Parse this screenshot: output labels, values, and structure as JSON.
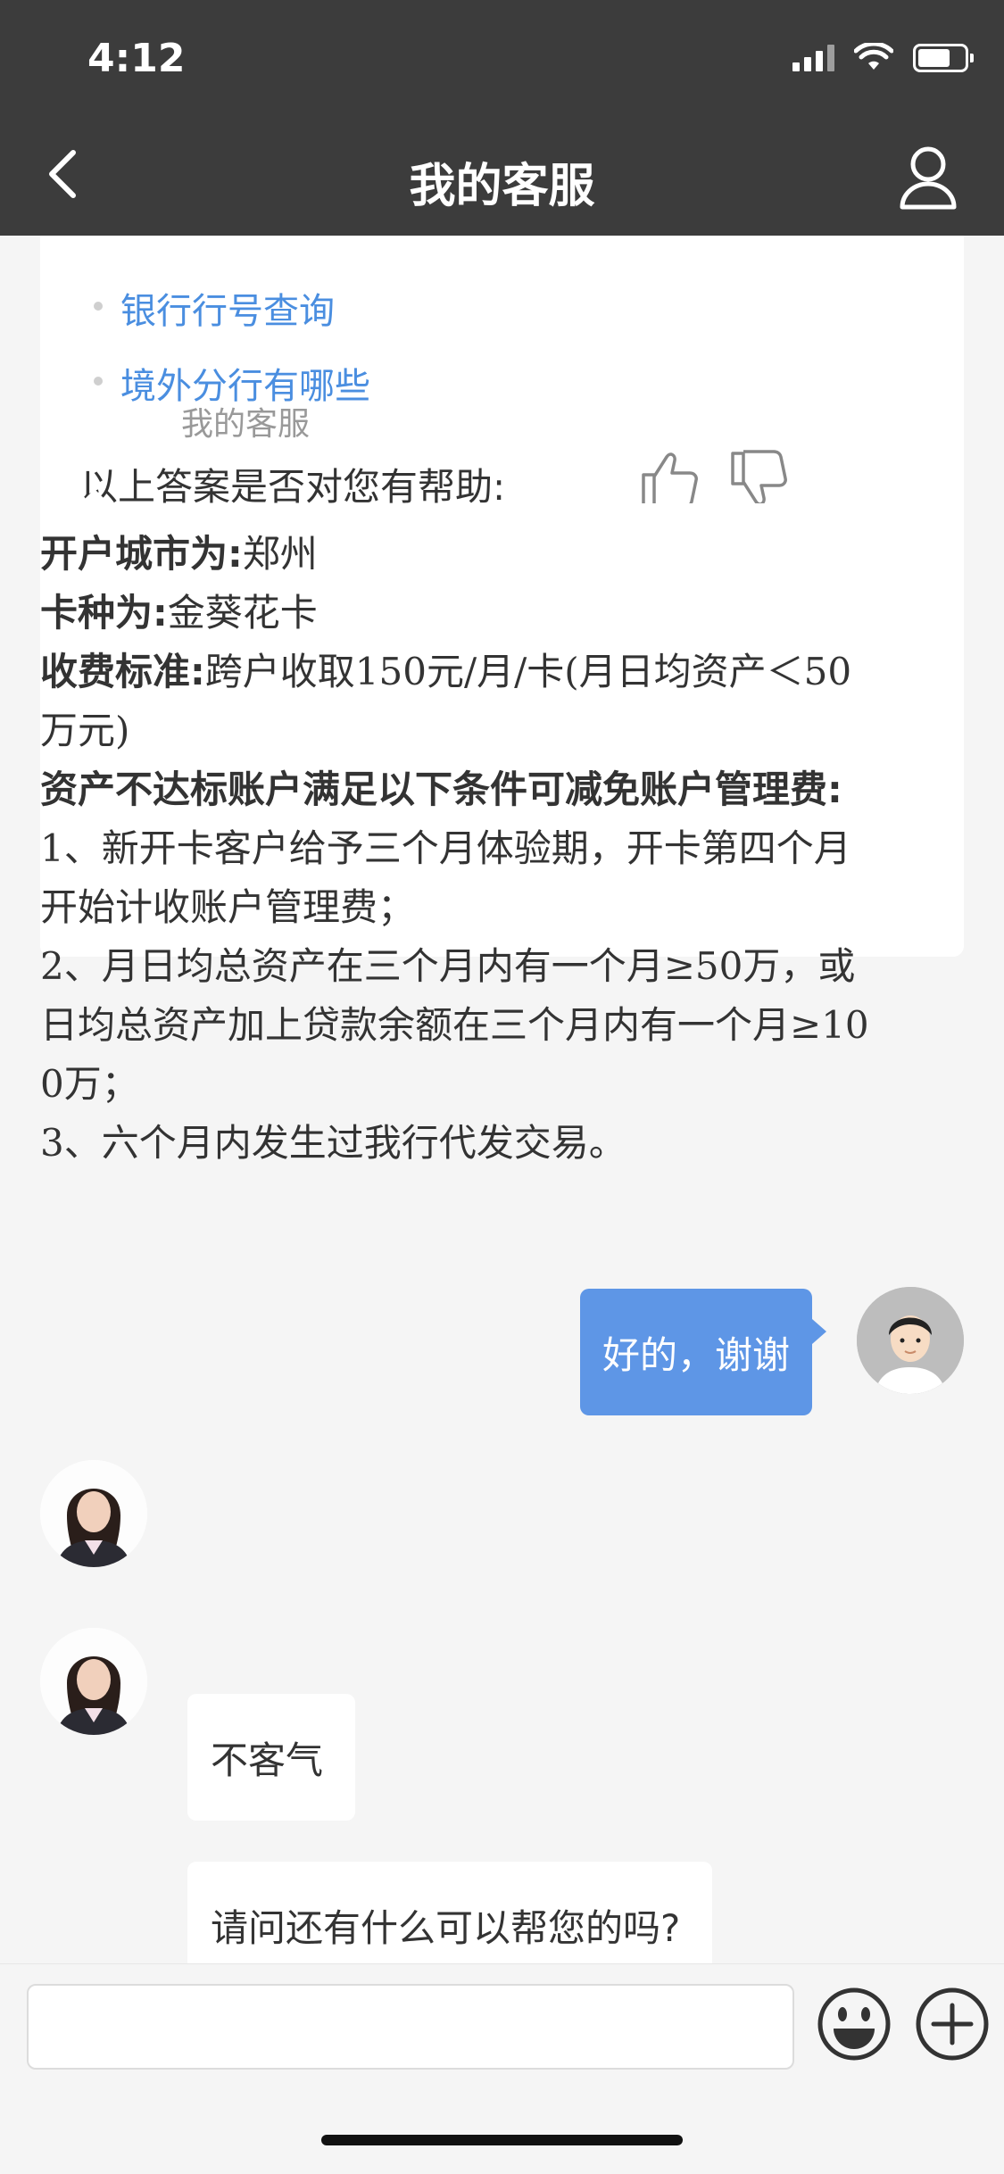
{
  "status_bar": {
    "time": "4:12"
  },
  "header": {
    "title": "我的客服"
  },
  "faq_card": {
    "links": [
      "银行行号查询",
      "境外分行有哪些"
    ],
    "helpful_question": "以上答案是否对您有帮助:"
  },
  "agent": {
    "name": "我的客服"
  },
  "answer": {
    "lines": [
      {
        "label": "开户城市为:",
        "text": "郑州"
      },
      {
        "label": "卡种为:",
        "text": "金葵花卡"
      },
      {
        "label": "收费标准:",
        "text": "跨户收取150元/月/卡(月日均资产＜50"
      },
      {
        "label": "",
        "text": "万元)"
      },
      {
        "label": "资产不达标账户满足以下条件可减免账户管理费:",
        "text": ""
      },
      {
        "label": "",
        "text": "1、新开卡客户给予三个月体验期，开卡第四个月"
      },
      {
        "label": "",
        "text": "开始计收账户管理费；"
      },
      {
        "label": "",
        "text": "2、月日均总资产在三个月内有一个月≥50万，或"
      },
      {
        "label": "",
        "text": "日均总资产加上贷款余额在三个月内有一个月≥10"
      },
      {
        "label": "",
        "text": "0万；"
      },
      {
        "label": "",
        "text": "3、六个月内发生过我行代发交易。"
      }
    ]
  },
  "messages": {
    "user_reply": "好的，谢谢",
    "agent_reply_1": "不客气",
    "agent_reply_2": "请问还有什么可以帮您的吗?"
  },
  "input": {
    "placeholder": ""
  },
  "colors": {
    "header_bg": "#3c3c3c",
    "link": "#4a8ee0",
    "user_bubble": "#5e96e6",
    "page_bg": "#f5f5f5"
  },
  "icons": [
    "back-arrow-icon",
    "user-profile-icon",
    "thumbs-up-icon",
    "thumbs-down-icon",
    "emoji-icon",
    "plus-icon",
    "signal-icon",
    "wifi-icon",
    "battery-icon"
  ]
}
